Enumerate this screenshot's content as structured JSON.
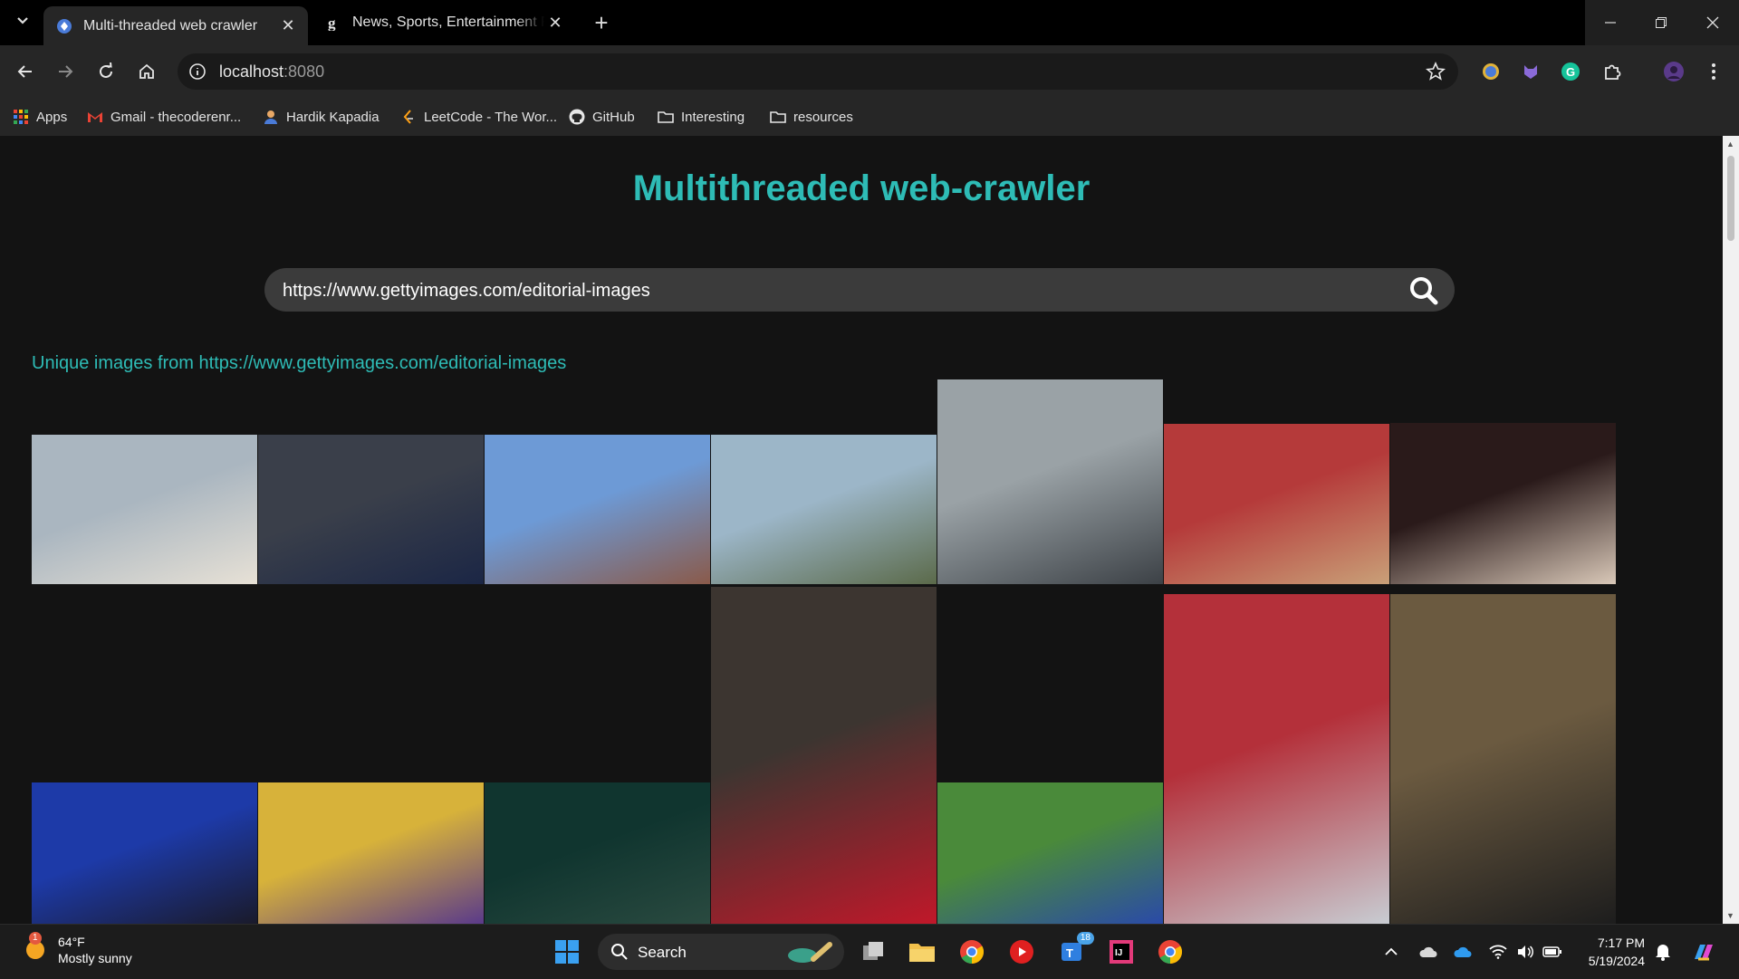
{
  "browser": {
    "tabs": [
      {
        "title": "Multi-threaded web crawler",
        "active": true,
        "favicon": "chrome-app-icon"
      },
      {
        "title": "News, Sports, Entertainment Ph",
        "active": false,
        "favicon": "getty-g-icon"
      }
    ],
    "address": {
      "host": "localhost",
      "port": ":8080"
    },
    "bookmarks": [
      {
        "label": "Apps",
        "icon": "apps-grid-icon"
      },
      {
        "label": "Gmail - thecoderenr...",
        "icon": "gmail-icon"
      },
      {
        "label": "Hardik Kapadia",
        "icon": "person-icon"
      },
      {
        "label": "LeetCode - The Wor...",
        "icon": "leetcode-icon"
      },
      {
        "label": "GitHub",
        "icon": "github-icon"
      },
      {
        "label": "Interesting",
        "icon": "folder-icon"
      },
      {
        "label": "resources",
        "icon": "folder-icon"
      }
    ]
  },
  "page": {
    "title": "Multithreaded web-crawler",
    "search_value": "https://www.gettyimages.com/editorial-images",
    "result_heading": "Unique images from https://www.gettyimages.com/editorial-images",
    "images": [
      {
        "name": "woman-on-balcony-cannes-photo",
        "colors": [
          "#aab6c0",
          "#e7e1d6"
        ]
      },
      {
        "name": "man-in-blue-suit-photo",
        "colors": [
          "#3a3f4a",
          "#1b2645"
        ]
      },
      {
        "name": "stadium-aerial-photo",
        "colors": [
          "#6d9ad6",
          "#8a5a4a"
        ]
      },
      {
        "name": "street-with-tents-photo",
        "colors": [
          "#9cb6c8",
          "#5b6a4a"
        ]
      },
      {
        "name": "trophy-over-river-photo",
        "colors": [
          "#9aa2a6",
          "#3c4146"
        ]
      },
      {
        "name": "wheelchair-basketball-photo",
        "colors": [
          "#b53a3a",
          "#c9a078"
        ]
      },
      {
        "name": "woman-in-white-gown-photo",
        "colors": [
          "#2a1a1a",
          "#d9c8b8"
        ]
      },
      {
        "name": "couple-at-party-photo",
        "colors": [
          "#3c3530",
          "#c0182a"
        ]
      },
      {
        "name": "rugby-trophy-photo",
        "colors": [
          "#b4303a",
          "#c8ccd2"
        ]
      },
      {
        "name": "two-people-in-room-photo",
        "colors": [
          "#6b5a40",
          "#1d1d1d"
        ]
      },
      {
        "name": "graduation-speech-photo",
        "colors": [
          "#1d3aa8",
          "#1a1a2a"
        ]
      },
      {
        "name": "football-team-celebrating-photo",
        "colors": [
          "#d7b23a",
          "#5a3a8a"
        ]
      },
      {
        "name": "singer-with-microphone-photo",
        "colors": [
          "#10352f",
          "#2a4a40"
        ]
      },
      {
        "name": "rugby-tackle-photo",
        "colors": [
          "#4a8a3a",
          "#2a4aa8"
        ]
      }
    ]
  },
  "taskbar": {
    "weather_temp": "64°F",
    "weather_desc": "Mostly sunny",
    "weather_badge": "1",
    "search_label": "Search",
    "teams_badge": "18",
    "time": "7:17 PM",
    "date": "5/19/2024"
  }
}
